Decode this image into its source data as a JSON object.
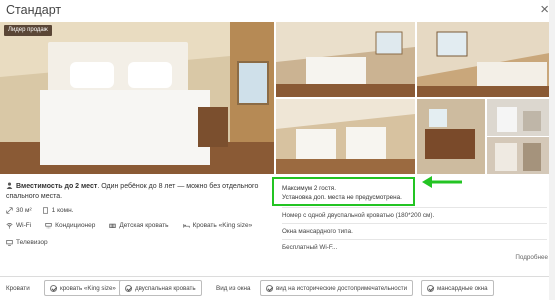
{
  "dialog": {
    "title": "Стандарт",
    "close_label": "×"
  },
  "gallery": {
    "badge": "Лидер продаж"
  },
  "room": {
    "capacity_bold": "Вместимость до 2 мест",
    "capacity_rest": ". Один ребёнок до 8 лет — можно без отдельного спального места.",
    "area": "30 м²",
    "rooms": "1 комн.",
    "amenities": [
      {
        "label": "Wi-Fi",
        "icon": "wifi-icon"
      },
      {
        "label": "Кондиционер",
        "icon": "air-conditioner-icon"
      },
      {
        "label": "Детская кровать",
        "icon": "crib-icon"
      },
      {
        "label": "Кровать «King size»",
        "icon": "bed-icon"
      },
      {
        "label": "Телевизор",
        "icon": "tv-icon"
      }
    ]
  },
  "highlight": {
    "line1": "Максимум 2 гостя.",
    "line2": "Установка доп. места не предусмотрена.",
    "color": "#23c423"
  },
  "details": {
    "bed": "Номер с одной двуспальной кроватью (180*200 см).",
    "window": "Окна мансардного типа.",
    "wifi": "Бесплатный Wi-F...",
    "more": "Подробнее"
  },
  "footer": {
    "beds_label": "Кровати",
    "bed_options": [
      "кровать «King size»",
      "двуспальная кровать"
    ],
    "view_label": "Вид из окна",
    "view_options": [
      "вид на исторические достопримечательности",
      "мансардные окна"
    ]
  }
}
